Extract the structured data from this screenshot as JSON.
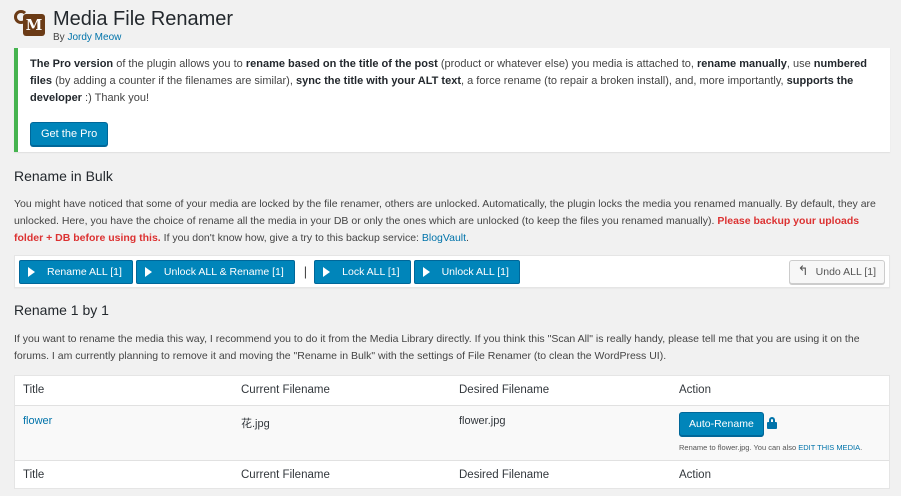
{
  "header": {
    "title": "Media File Renamer",
    "by": "By",
    "author": "Jordy Meow",
    "logo_letter": "M"
  },
  "pro_notice": {
    "lead_bold": "The Pro version",
    "t1": " of the plugin allows you to ",
    "b1": "rename based on the title of the post",
    "t2": " (product or whatever else) you media is attached to, ",
    "b2": "rename manually",
    "t3": ", use ",
    "b3": "numbered files",
    "t4": " (by adding a counter if the filenames are similar), ",
    "b4": "sync the title with your ALT text",
    "t5": ", a force rename (to repair a broken install), and, more importantly, ",
    "b5": "supports the developer",
    "t6": " :) Thank you!",
    "button": "Get the Pro",
    "accent": "#46b450"
  },
  "bulk": {
    "heading": "Rename in Bulk",
    "text1": "You might have noticed that some of your media are locked by the file renamer, others are unlocked. Automatically, the plugin locks the media you renamed manually. By default, they are unlocked. Here, you have the choice of rename all the media in your DB or only the ones which are unlocked (to keep the files you renamed manually). ",
    "warning": "Please backup your uploads folder + DB before using this.",
    "text2": " If you don't know how, give a try to this backup service: ",
    "link": "BlogVault",
    "text3": ".",
    "buttons": [
      "Rename ALL [1]",
      "Unlock ALL & Rename [1]",
      "Lock ALL [1]",
      "Unlock ALL [1]"
    ],
    "separator": "|",
    "undo": "Undo ALL [1]",
    "undo_icon": "undo-icon",
    "play_icon": "play-icon"
  },
  "single": {
    "heading": "Rename 1 by 1",
    "text": "If you want to rename the media this way, I recommend you to do it from the Media Library directly. If you think this \"Scan All\" is really handy, please tell me that you are using it on the forums. I am currently planning to remove it and moving the \"Rename in Bulk\" with the settings of File Renamer (to clean the WordPress UI)."
  },
  "table": {
    "columns": [
      "Title",
      "Current Filename",
      "Desired Filename",
      "Action"
    ],
    "rows": [
      {
        "title": "flower",
        "current": "花.jpg",
        "desired": "flower.jpg",
        "action_button": "Auto-Rename",
        "hint_pre": "Rename to flower.jpg. You can also ",
        "hint_link": "EDIT THIS MEDIA",
        "hint_post": "."
      }
    ]
  },
  "colors": {
    "primary": "#0085ba",
    "link": "#0073aa",
    "warning": "#dc3232"
  }
}
